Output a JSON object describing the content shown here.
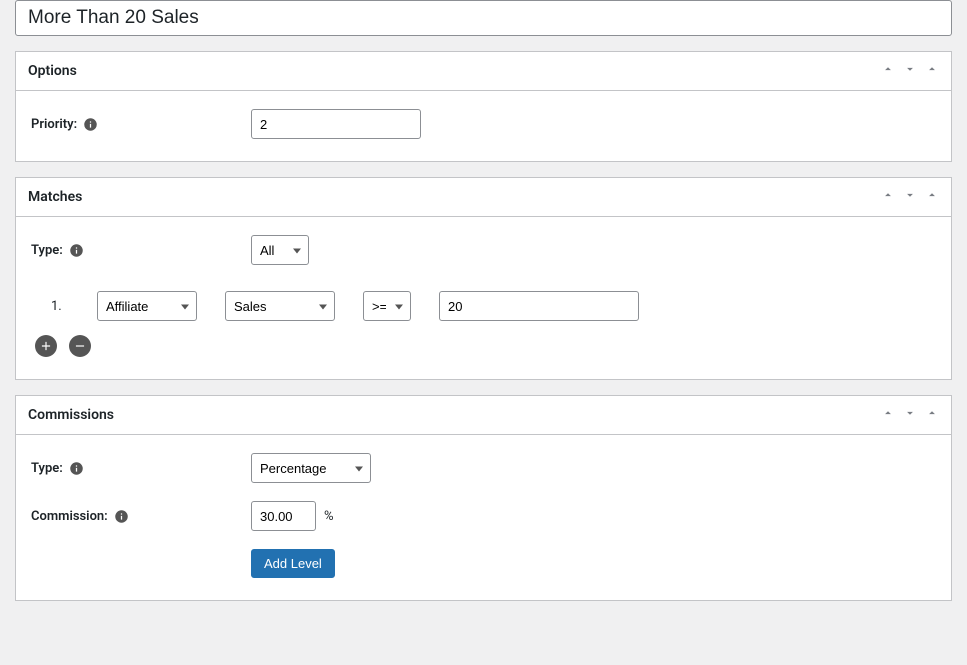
{
  "title": "More Than 20 Sales",
  "panels": {
    "options": {
      "title": "Options",
      "priority_label": "Priority:",
      "priority_value": "2"
    },
    "matches": {
      "title": "Matches",
      "type_label": "Type:",
      "type_value": "All",
      "rules": [
        {
          "index": "1.",
          "subject": "Affiliate",
          "metric": "Sales",
          "operator": ">=",
          "value": "20"
        }
      ]
    },
    "commissions": {
      "title": "Commissions",
      "type_label": "Type:",
      "type_value": "Percentage",
      "commission_label": "Commission:",
      "commission_value": "30.00",
      "commission_suffix": "%",
      "add_level_label": "Add Level"
    }
  }
}
